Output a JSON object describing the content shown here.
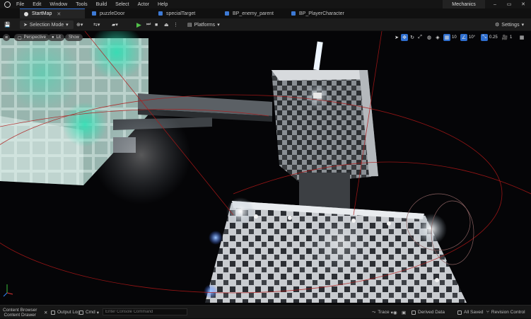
{
  "menubar": {
    "items": [
      "File",
      "Edit",
      "Window",
      "Tools",
      "Build",
      "Select",
      "Actor",
      "Help"
    ],
    "project_name": "Mechanics"
  },
  "tabs": [
    {
      "label": "StartMap"
    },
    {
      "label": "puzzleDoor"
    },
    {
      "label": "specialTarget"
    },
    {
      "label": "BP_enemy_parent"
    },
    {
      "label": "BP_PlayerCharacter"
    }
  ],
  "toolbar": {
    "selection_mode": "Selection Mode",
    "platforms": "Platforms",
    "settings": "Settings"
  },
  "viewport": {
    "perspective": "Perspective",
    "lit": "Lit",
    "show": "Show",
    "grid_snap": "10",
    "rotation_snap": "10°",
    "scale_snap": "0.25",
    "camera_speed": "1"
  },
  "bottombar": {
    "content_drawer": "Content Drawer",
    "content_browser": "Content Browser",
    "output_log": "Output Log",
    "cmd": "Cmd",
    "console_placeholder": "Enter Console Command",
    "trace": "Trace",
    "derived_data": "Derived Data",
    "all_saved": "All Saved",
    "revision_control": "Revision Control"
  },
  "colors": {
    "accent": "#2f6fd0",
    "play": "#52c24a",
    "teal_glow": "#2fe0b5",
    "red_line": "#b01818"
  }
}
